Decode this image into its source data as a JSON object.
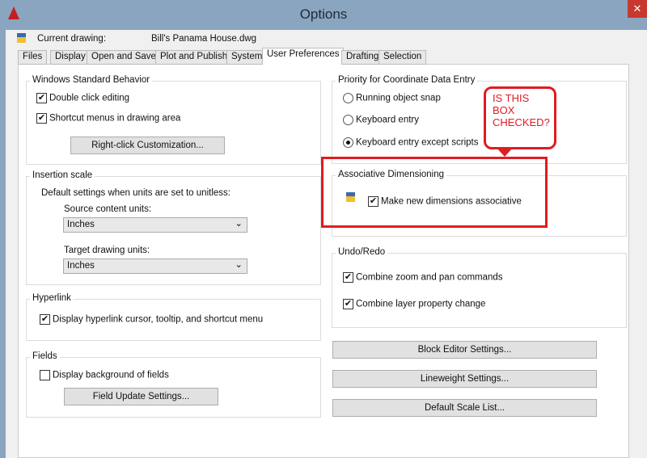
{
  "window": {
    "title": "Options",
    "close": "✕"
  },
  "header": {
    "current_drawing_label": "Current drawing:",
    "current_drawing": "Bill's Panama House.dwg"
  },
  "tabs": [
    "Files",
    "Display",
    "Open and Save",
    "Plot and Publish",
    "System",
    "User Preferences",
    "Drafting",
    "Selection"
  ],
  "active_tab": "User Preferences",
  "windows_behavior": {
    "title": "Windows Standard Behavior",
    "double_click": "Double click editing",
    "shortcut_menus": "Shortcut menus in drawing area",
    "right_click_button": "Right-click Customization..."
  },
  "insertion_scale": {
    "title": "Insertion scale",
    "desc": "Default settings when units are set to unitless:",
    "source_label": "Source content units:",
    "source_value": "Inches",
    "target_label": "Target drawing units:",
    "target_value": "Inches"
  },
  "hyperlink": {
    "title": "Hyperlink",
    "option": "Display hyperlink cursor, tooltip, and shortcut menu"
  },
  "fields": {
    "title": "Fields",
    "option": "Display background of fields",
    "button": "Field Update Settings..."
  },
  "priority": {
    "title": "Priority for Coordinate Data Entry",
    "options": [
      "Running object snap",
      "Keyboard entry",
      "Keyboard entry except scripts"
    ],
    "selected": "Keyboard entry except scripts"
  },
  "assoc": {
    "title": "Associative Dimensioning",
    "option": "Make new dimensions associative"
  },
  "undo": {
    "title": "Undo/Redo",
    "combine_zoom": "Combine zoom and pan commands",
    "combine_layer": "Combine layer property change"
  },
  "buttons": {
    "block_editor": "Block Editor Settings...",
    "lineweight": "Lineweight Settings...",
    "default_scale": "Default Scale List..."
  },
  "annotation": {
    "text": "IS THIS BOX CHECKED?",
    "color": "#e11b22"
  },
  "check": "✔",
  "chevron": "⌄"
}
